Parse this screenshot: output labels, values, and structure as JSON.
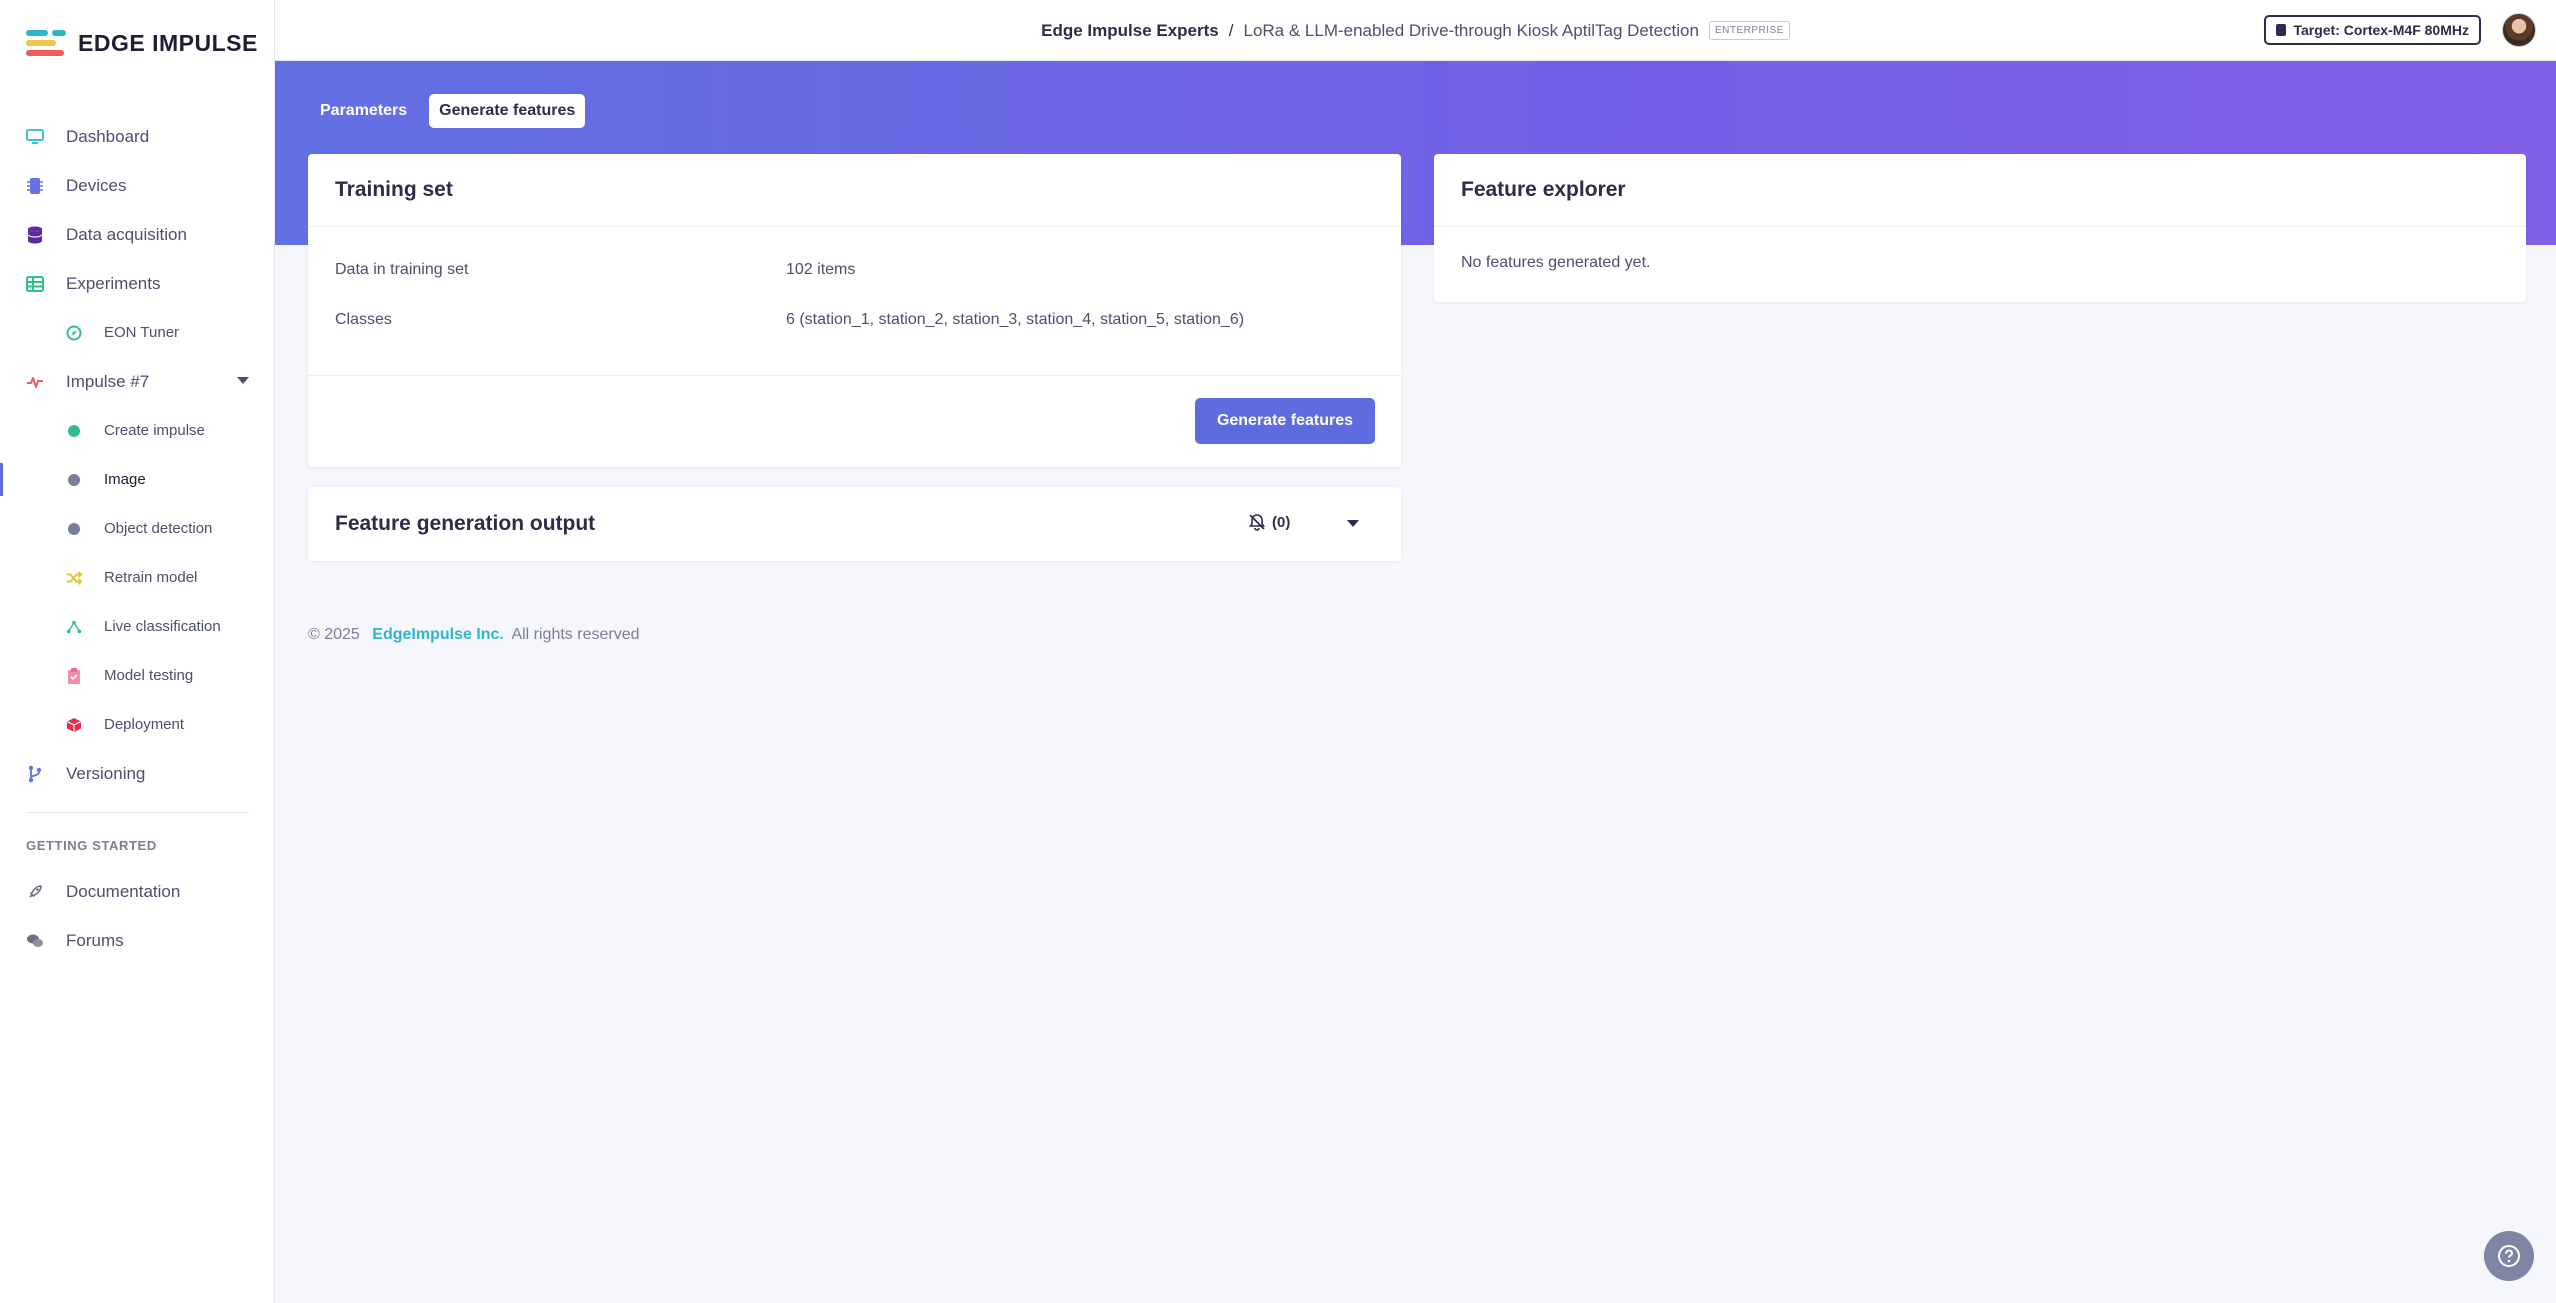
{
  "app": {
    "name": "EDGE IMPULSE"
  },
  "colors": {
    "accent": "#5e6ce0",
    "link": "#2fb5c9",
    "hero_start": "#6270e2",
    "hero_end": "#8360e8"
  },
  "sidebar": {
    "items": [
      {
        "label": "Dashboard",
        "icon": "monitor-icon"
      },
      {
        "label": "Devices",
        "icon": "chip-icon"
      },
      {
        "label": "Data acquisition",
        "icon": "database-icon"
      },
      {
        "label": "Experiments",
        "icon": "table-icon"
      },
      {
        "label": "EON Tuner",
        "icon": "compass-icon"
      },
      {
        "label": "Impulse #7",
        "icon": "pulse-icon"
      },
      {
        "label": "Create impulse",
        "icon": "dot-green-icon"
      },
      {
        "label": "Image",
        "icon": "dot-gray-icon"
      },
      {
        "label": "Object detection",
        "icon": "dot-gray-icon"
      },
      {
        "label": "Retrain model",
        "icon": "shuffle-icon"
      },
      {
        "label": "Live classification",
        "icon": "network-icon"
      },
      {
        "label": "Model testing",
        "icon": "clipboard-icon"
      },
      {
        "label": "Deployment",
        "icon": "box-icon"
      },
      {
        "label": "Versioning",
        "icon": "branch-icon"
      }
    ],
    "section_label": "GETTING STARTED",
    "getting_started": [
      {
        "label": "Documentation",
        "icon": "rocket-icon"
      },
      {
        "label": "Forums",
        "icon": "chat-icon"
      }
    ]
  },
  "header": {
    "org": "Edge Impulse Experts",
    "separator": "/",
    "project": "LoRa & LLM-enabled Drive-through Kiosk AptilTag Detection",
    "badge": "ENTERPRISE",
    "target": "Target: Cortex-M4F 80MHz"
  },
  "tabs": [
    {
      "label": "Parameters"
    },
    {
      "label": "Generate features"
    }
  ],
  "training_set": {
    "title": "Training set",
    "rows": [
      {
        "label": "Data in training set",
        "value": "102 items"
      },
      {
        "label": "Classes",
        "value": "6 (station_1, station_2, station_3, station_4, station_5, station_6)"
      }
    ],
    "button": "Generate features"
  },
  "feature_output": {
    "title": "Feature generation output",
    "count": "(0)"
  },
  "feature_explorer": {
    "title": "Feature explorer",
    "empty": "No features generated yet."
  },
  "footer": {
    "copyright": "© 2025",
    "company": "EdgeImpulse Inc.",
    "rights": "All rights reserved"
  }
}
